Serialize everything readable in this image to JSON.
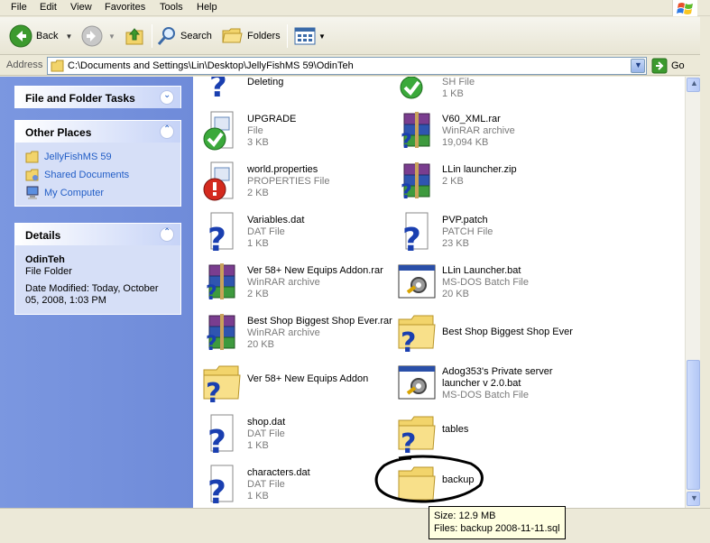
{
  "menu": [
    "File",
    "Edit",
    "View",
    "Favorites",
    "Tools",
    "Help"
  ],
  "toolbar": {
    "back": "Back",
    "search": "Search",
    "folders": "Folders"
  },
  "address": {
    "label": "Address",
    "path": "C:\\Documents and Settings\\Lin\\Desktop\\JellyFishMS 59\\OdinTeh",
    "go": "Go"
  },
  "taskpane": {
    "file_folder_tasks": "File and Folder Tasks",
    "other_places": {
      "title": "Other Places",
      "links": [
        "JellyFishMS 59",
        "Shared Documents",
        "My Computer"
      ]
    },
    "details": {
      "title": "Details",
      "name": "OdinTeh",
      "type": "File Folder",
      "modified": "Date Modified: Today, October 05, 2008, 1:03 PM"
    }
  },
  "files": [
    {
      "name": "Deleting",
      "type": "",
      "size": "",
      "icon": "bat-check-icon"
    },
    {
      "name": "",
      "type": "SH File",
      "size": "1 KB",
      "icon": "check-file-icon"
    },
    {
      "name": "UPGRADE",
      "type": "File",
      "size": "3 KB",
      "icon": "check-file-icon"
    },
    {
      "name": "V60_XML.rar",
      "type": "WinRAR archive",
      "size": "19,094 KB",
      "icon": "winrar-icon"
    },
    {
      "name": "world.properties",
      "type": "PROPERTIES File",
      "size": "2 KB",
      "icon": "error-file-icon"
    },
    {
      "name": "LLin launcher.zip",
      "type": "",
      "size": "2 KB",
      "icon": "winrar-icon"
    },
    {
      "name": "Variables.dat",
      "type": "DAT File",
      "size": "1 KB",
      "icon": "unknown-file-icon"
    },
    {
      "name": "PVP.patch",
      "type": "PATCH File",
      "size": "23 KB",
      "icon": "unknown-file-icon"
    },
    {
      "name": "Ver 58+ New Equips Addon.rar",
      "type": "WinRAR archive",
      "size": "2 KB",
      "icon": "winrar-icon"
    },
    {
      "name": "LLin Launcher.bat",
      "type": "MS-DOS Batch File",
      "size": "20 KB",
      "icon": "batch-file-icon"
    },
    {
      "name": "Best Shop Biggest Shop Ever.rar",
      "type": "WinRAR archive",
      "size": "20 KB",
      "icon": "winrar-icon"
    },
    {
      "name": "Best Shop Biggest Shop Ever",
      "type": "",
      "size": "",
      "icon": "folder-unknown-icon"
    },
    {
      "name": "Ver 58+ New Equips Addon",
      "type": "",
      "size": "",
      "icon": "folder-unknown-icon"
    },
    {
      "name": "Adog353's Private server launcher v 2.0.bat",
      "type": "MS-DOS Batch File",
      "size": "",
      "icon": "batch-file-icon"
    },
    {
      "name": "shop.dat",
      "type": "DAT File",
      "size": "1 KB",
      "icon": "unknown-file-icon"
    },
    {
      "name": "tables",
      "type": "",
      "size": "",
      "icon": "folder-unknown-icon"
    },
    {
      "name": "characters.dat",
      "type": "DAT File",
      "size": "1 KB",
      "icon": "unknown-file-icon"
    },
    {
      "name": "backup",
      "type": "",
      "size": "",
      "icon": "folder-icon"
    }
  ],
  "tooltip": {
    "size": "Size: 12.9 MB",
    "files": "Files: backup 2008-11-11.sql"
  }
}
